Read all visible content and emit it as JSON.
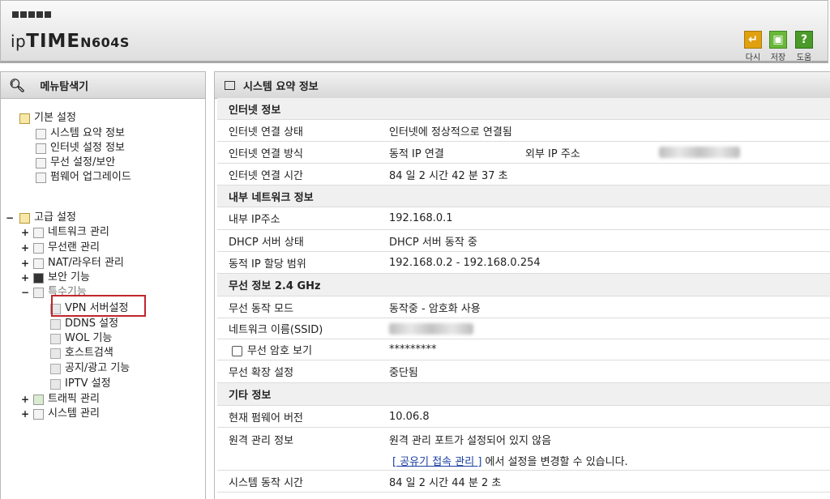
{
  "header": {
    "brand_prefix": "ip",
    "brand_main": "TIME",
    "model": "N604S",
    "buttons": [
      {
        "label": "다시",
        "icon": "undo-icon",
        "color": "#e0a010"
      },
      {
        "label": "저장",
        "icon": "save-icon",
        "color": "#6ab83a"
      },
      {
        "label": "도움",
        "icon": "help-icon",
        "color": "#4a9a2a",
        "glyph": "?"
      }
    ]
  },
  "sidebar": {
    "title": "메뉴탐색기",
    "basic": {
      "label": "기본 설정",
      "items": [
        "시스템 요약 정보",
        "인터넷 설정 정보",
        "무선 설정/보안",
        "펌웨어 업그레이드"
      ]
    },
    "advanced": {
      "label": "고급 설정",
      "items": [
        "네트워크 관리",
        "무선랜 관리",
        "NAT/라우터 관리",
        "보안 기능",
        "특수기능"
      ],
      "special_items": [
        "VPN 서버설정",
        "DDNS 설정",
        "WOL 기능",
        "호스트검색",
        "공지/광고 기능",
        "IPTV 설정"
      ],
      "after_items": [
        "트래픽 관리",
        "시스템 관리"
      ]
    }
  },
  "main": {
    "title": "시스템 요약 정보",
    "internet": {
      "section": "인터넷 정보",
      "status_label": "인터넷 연결 상태",
      "status_value": "인터넷에 정상적으로 연결됨",
      "method_label": "인터넷 연결 방식",
      "method_value": "동적 IP 연결",
      "ext_ip_label": "외부 IP 주소",
      "time_label": "인터넷 연결 시간",
      "time_value": "84 일 2 시간 42 분 37 초"
    },
    "lan": {
      "section": "내부 네트워크 정보",
      "ip_label": "내부 IP주소",
      "ip_value": "192.168.0.1",
      "dhcp_label": "DHCP 서버 상태",
      "dhcp_value": "DHCP 서버 동작 중",
      "range_label": "동적 IP 할당 범위",
      "range_value": "192.168.0.2 -  192.168.0.254"
    },
    "wireless": {
      "section": "무선 정보 2.4 GHz",
      "mode_label": "무선 동작 모드",
      "mode_value": "동작중 - 암호화 사용",
      "ssid_label": "네트워크 이름(SSID)",
      "pw_label": "무선 암호 보기",
      "pw_value": "*********",
      "ext_label": "무선 확장 설정",
      "ext_value": "중단됨"
    },
    "other": {
      "section": "기타 정보",
      "fw_label": "현재 펌웨어 버전",
      "fw_value": "10.06.8",
      "remote_label": "원격 관리 정보",
      "remote_value": "원격 관리 포트가 설정되어 있지 않음",
      "remote_link": "[ 공유기 접속 관리 ]",
      "remote_suffix": " 에서 설정을 변경할 수 있습니다.",
      "uptime_label": "시스템 동작 시간",
      "uptime_value": "84 일 2 시간 44 분 2 초"
    }
  }
}
